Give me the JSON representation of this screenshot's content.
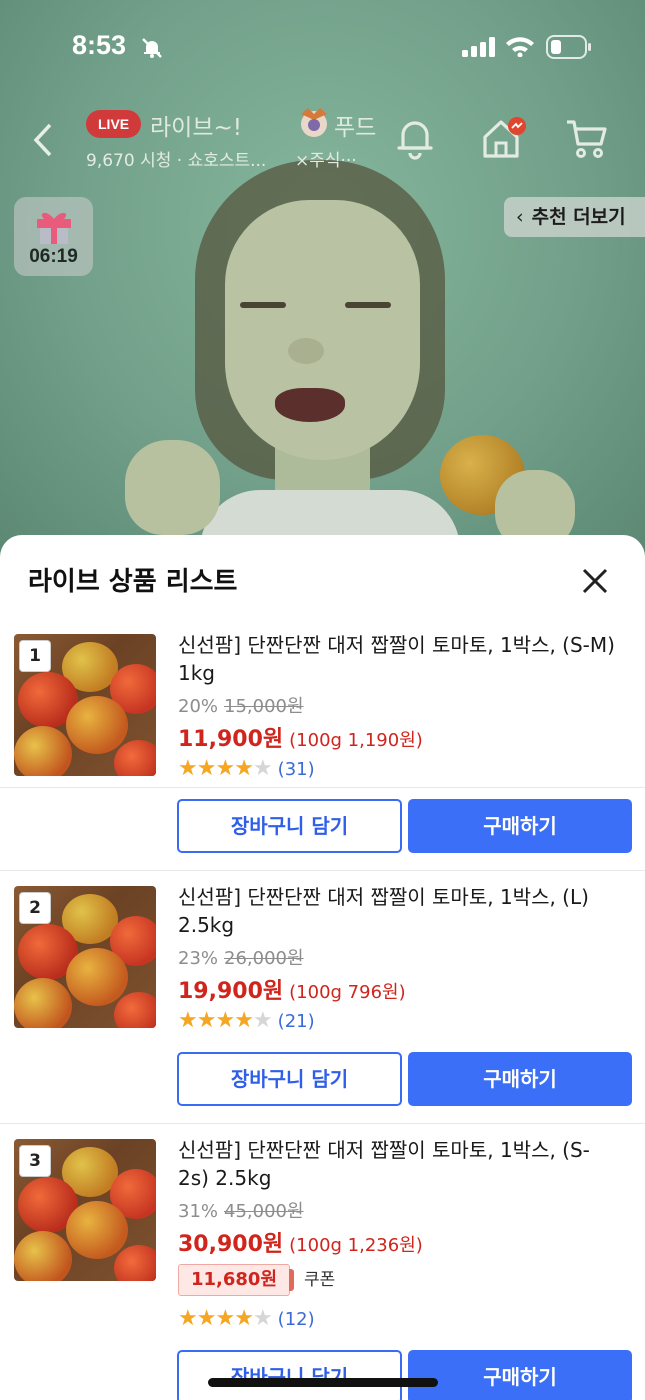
{
  "status_bar": {
    "time": "8:53"
  },
  "live": {
    "badge": "LIVE",
    "title": "라이브~!",
    "viewers": "9,670 시청 · 쇼호스트...",
    "brand": "푸드",
    "company": "×주식···"
  },
  "gift_timer": {
    "time": "06:19"
  },
  "recommend": {
    "label": "추천 더보기"
  },
  "sheet": {
    "title": "라이브 상품 리스트",
    "products": [
      {
        "rank": "1",
        "name": "신선팜] 단짠단짠 대저 짭짤이 토마토, 1박스, (S-M) 1kg",
        "discount": "20%",
        "original_price": "15,000원",
        "price": "11,900원",
        "unit_price": "(100g 1,190원)",
        "rating": 4,
        "reviews": "(31)",
        "cart_label": "장바구니 담기",
        "buy_label": "구매하기"
      },
      {
        "rank": "2",
        "name": "신선팜] 단짠단짠 대저 짭짤이 토마토, 1박스, (L) 2.5kg",
        "discount": "23%",
        "original_price": "26,000원",
        "price": "19,900원",
        "unit_price": "(100g 796원)",
        "rating": 4,
        "reviews": "(21)",
        "cart_label": "장바구니 담기",
        "buy_label": "구매하기"
      },
      {
        "rank": "3",
        "name": "신선팜] 단짠단짠 대저 짭짤이 토마토, 1박스, (S-2s) 2.5kg",
        "discount": "31%",
        "original_price": "45,000원",
        "price": "30,900원",
        "unit_price": "(100g 1,236원)",
        "coupon_price": "11,680원",
        "coupon_label": "쿠폰",
        "rating": 4,
        "reviews": "(12)",
        "cart_label": "장바구니 담기",
        "buy_label": "구매하기"
      }
    ]
  },
  "colors": {
    "accent_blue": "#3b6ff7",
    "price_red": "#d0251c",
    "star": "#f5a623",
    "live_red": "#d13a3a"
  }
}
